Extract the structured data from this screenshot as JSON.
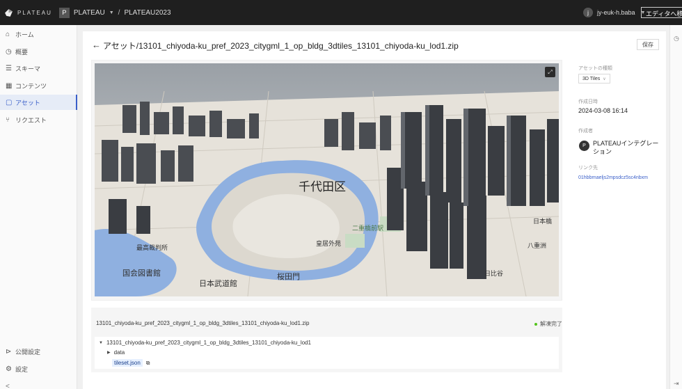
{
  "topbar": {
    "logo_text": "PLATEAU",
    "workspace_badge": "P",
    "workspace_name": "PLATEAU",
    "separator": "/",
    "project_name": "PLATEAU2023",
    "user_avatar": "j",
    "user_name": "jy-euk-h.baba",
    "editor_button": "エディタへ移動"
  },
  "sidebar": {
    "items": [
      {
        "label": "ホーム",
        "icon": "home-icon",
        "glyph": "⌂"
      },
      {
        "label": "概要",
        "icon": "clock-icon",
        "glyph": "◷"
      },
      {
        "label": "スキーマ",
        "icon": "list-icon",
        "glyph": "☰"
      },
      {
        "label": "コンテンツ",
        "icon": "table-icon",
        "glyph": "▦"
      },
      {
        "label": "アセット",
        "icon": "file-icon",
        "glyph": "▢"
      },
      {
        "label": "リクエスト",
        "icon": "pull-request-icon",
        "glyph": "⑂"
      }
    ],
    "bottom_items": [
      {
        "label": "公開設定",
        "icon": "send-icon",
        "glyph": "⊳"
      },
      {
        "label": "設定",
        "icon": "gear-icon",
        "glyph": "⚙"
      }
    ],
    "collapse_glyph": "<"
  },
  "header": {
    "back_glyph": "←",
    "title": "アセット/13101_chiyoda-ku_pref_2023_citygml_1_op_bldg_3dtiles_13101_chiyoda-ku_lod1.zip",
    "save_label": "保存"
  },
  "viewer": {
    "fullscreen_glyph": "⤢",
    "map_labels": {
      "ward": "千代田区",
      "place_a": "日本武道館",
      "place_b": "皇居外苑",
      "place_c": "桜田門",
      "place_d": "国会図書館",
      "place_e": "最高裁判所",
      "place_f": "二重橋前駅",
      "place_g": "八重洲",
      "place_h": "日本橋",
      "place_i": "日比谷"
    }
  },
  "file": {
    "name": "13101_chiyoda-ku_pref_2023_citygml_1_op_bldg_3dtiles_13101_chiyoda-ku_lod1.zip",
    "status": "解凍完了",
    "status_color": "#52c41a",
    "tree": {
      "root": "13101_chiyoda-ku_pref_2023_citygml_1_op_bldg_3dtiles_13101_chiyoda-ku_lod1",
      "folder": "data",
      "file": "tileset.json"
    }
  },
  "info": {
    "type_label": "アセットの種類",
    "type_value": "3D Tiles",
    "created_label": "作成日時",
    "created_value": "2024-03-08 16:14",
    "creator_label": "作成者",
    "creator_avatar": "P",
    "creator_name": "PLATEAUインテグレーション",
    "link_label": "リンク先",
    "link_value": "01hbbrnaeljs2mpsdcz5sc4nbxm"
  },
  "colors": {
    "accent": "#3a5fc9",
    "topbar": "#1f1f1f"
  }
}
